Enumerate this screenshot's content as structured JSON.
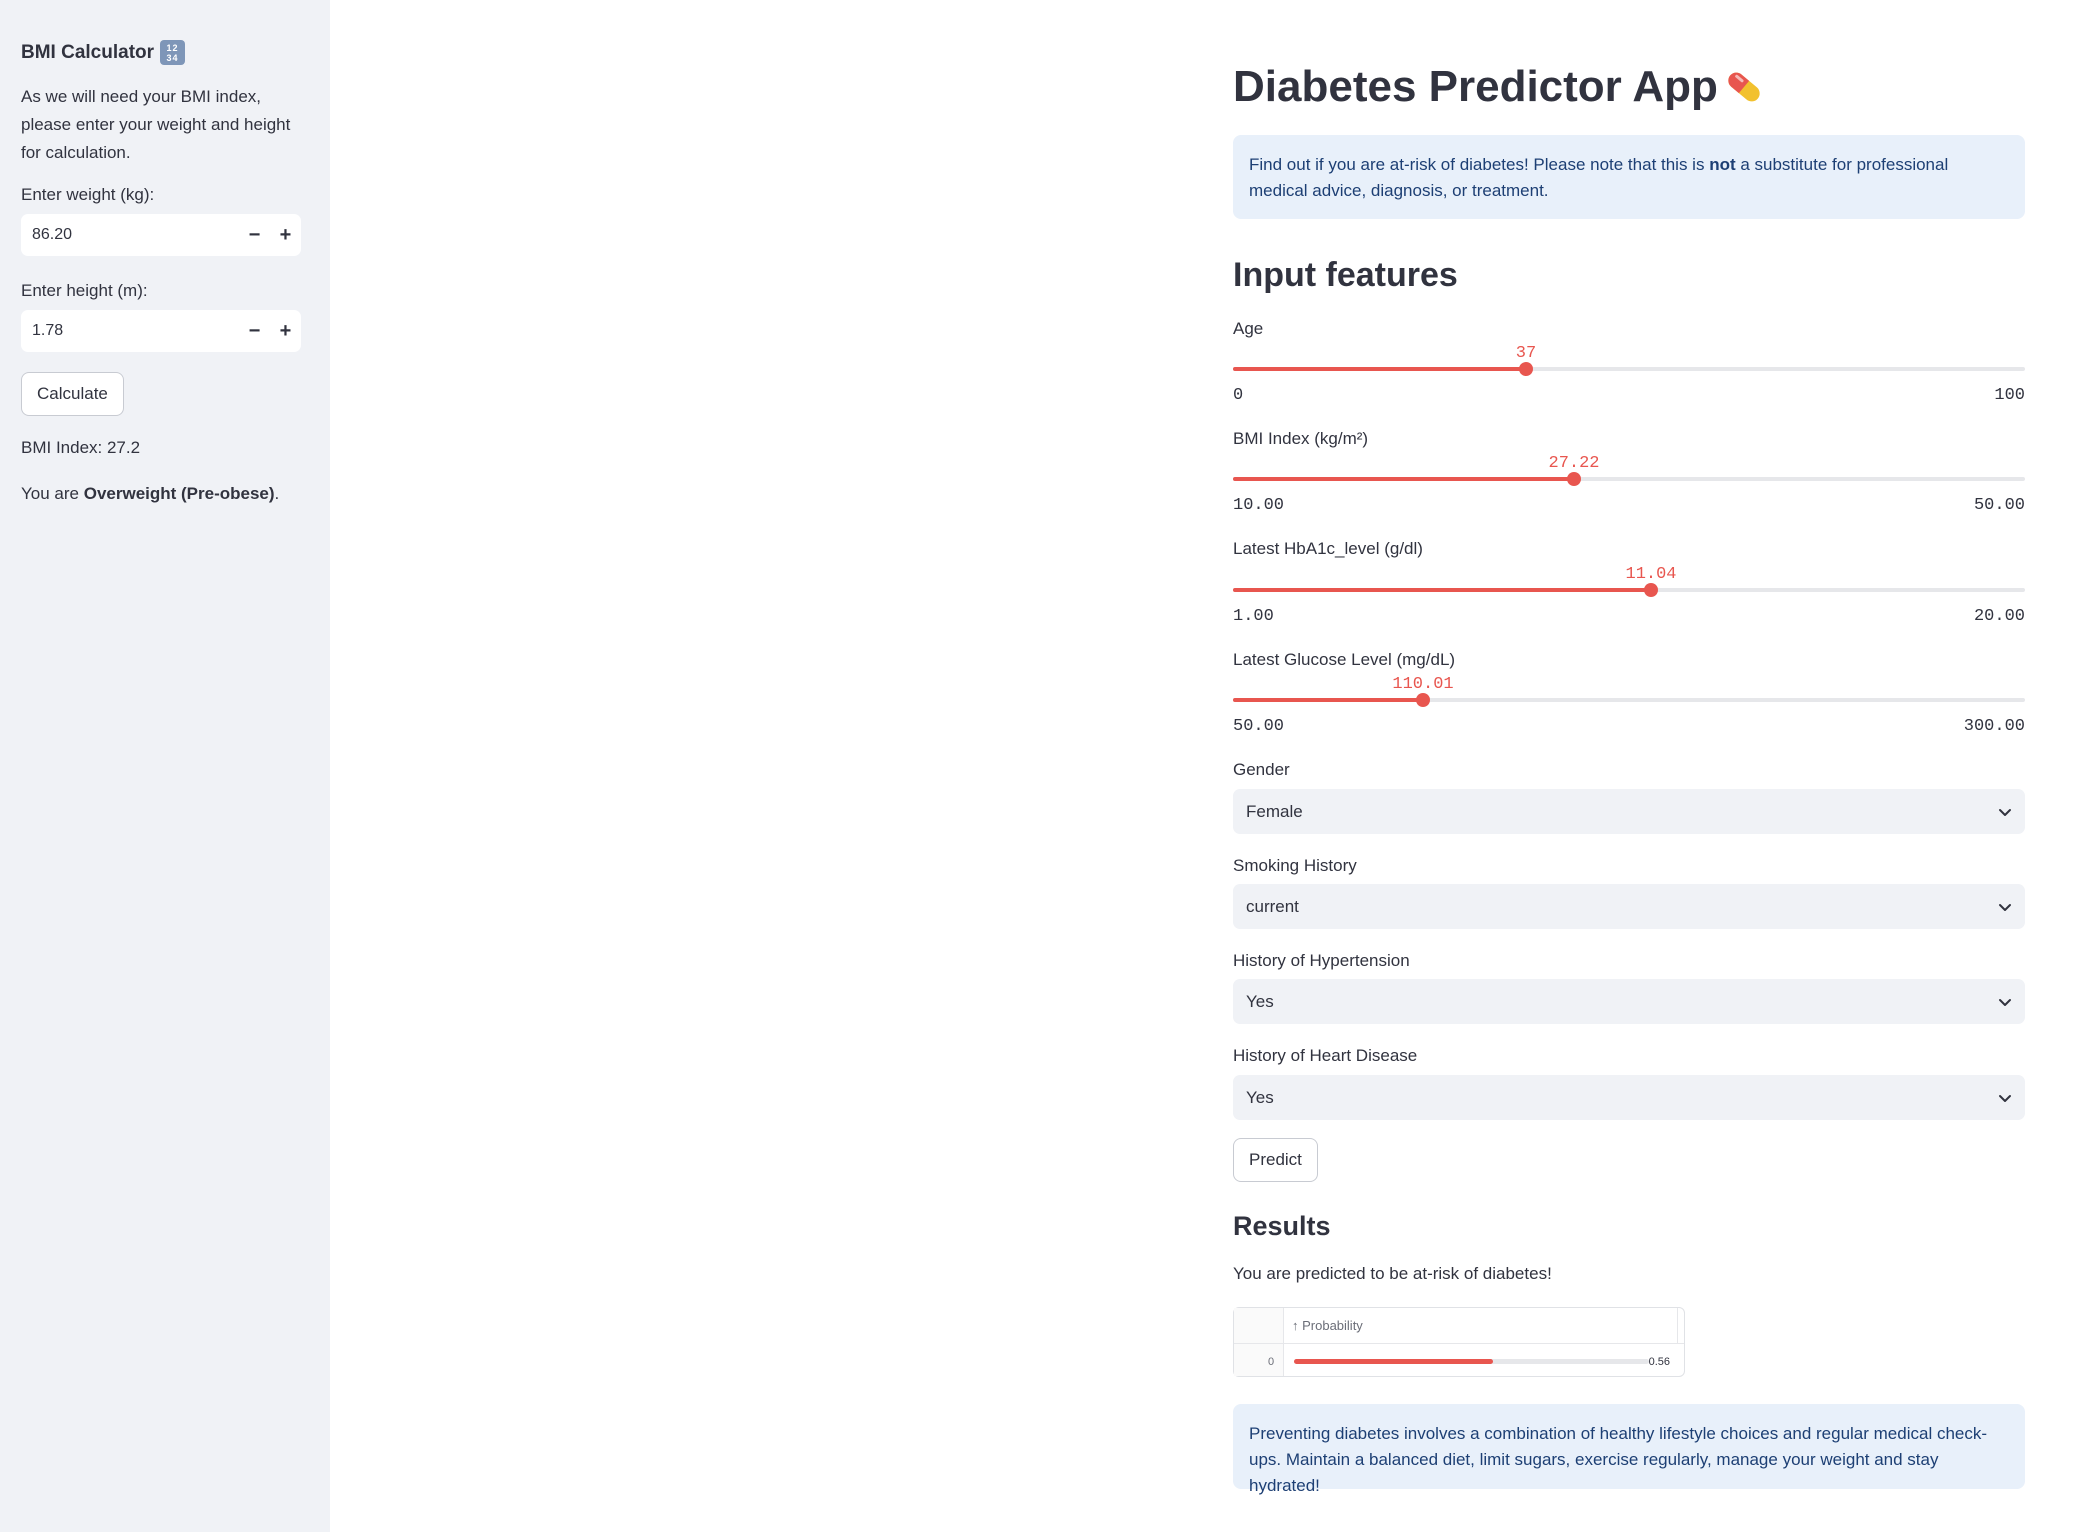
{
  "sidebar": {
    "title": "BMI Calculator",
    "title_icon": "keypad-1234-icon",
    "description": "As we will need your BMI index, please enter your weight and height for calculation.",
    "weight_label": "Enter weight (kg):",
    "weight_value": "86.20",
    "height_label": "Enter height (m):",
    "height_value": "1.78",
    "minus": "−",
    "plus": "+",
    "calculate_label": "Calculate",
    "bmi_result": "BMI Index: 27.2",
    "category_prefix": "You are ",
    "category": "Overweight (Pre-obese)",
    "category_suffix": "."
  },
  "main": {
    "title": "Diabetes Predictor App",
    "title_icon": "pill-icon",
    "intro_prefix": "Find out if you are at-risk of diabetes! Please note that this is ",
    "intro_bold": "not",
    "intro_suffix": " a substitute for professional medical advice, diagnosis, or treatment.",
    "features_heading": "Input features",
    "sliders": [
      {
        "label": "Age",
        "value": "37",
        "min": "0",
        "max": "100",
        "fraction": 0.37
      },
      {
        "label": "BMI Index (kg/m²)",
        "value": "27.22",
        "min": "10.00",
        "max": "50.00",
        "fraction": 0.4305
      },
      {
        "label": "Latest HbA1c_level (g/dl)",
        "value": "11.04",
        "min": "1.00",
        "max": "20.00",
        "fraction": 0.5284
      },
      {
        "label": "Latest Glucose Level (mg/dL)",
        "value": "110.01",
        "min": "50.00",
        "max": "300.00",
        "fraction": 0.24
      }
    ],
    "selects": [
      {
        "label": "Gender",
        "value": "Female"
      },
      {
        "label": "Smoking History",
        "value": "current"
      },
      {
        "label": "History of Hypertension",
        "value": "Yes"
      },
      {
        "label": "History of Heart Disease",
        "value": "Yes"
      }
    ],
    "predict_label": "Predict",
    "results_heading": "Results",
    "result_text": "You are predicted to be at-risk of diabetes!",
    "table": {
      "column": "↑ Probability",
      "index": "0",
      "value": "0.56",
      "fraction": 0.56
    },
    "advice": "Preventing diabetes involves a combination of healthy lifestyle choices and regular medical check-ups. Maintain a balanced diet, limit sugars, exercise regularly, manage your weight and stay hydrated!"
  },
  "colors": {
    "accent": "#e8564f",
    "sidebar_bg": "#f0f2f6",
    "info_bg": "#e8f0fa",
    "info_text": "#1d3f74"
  }
}
